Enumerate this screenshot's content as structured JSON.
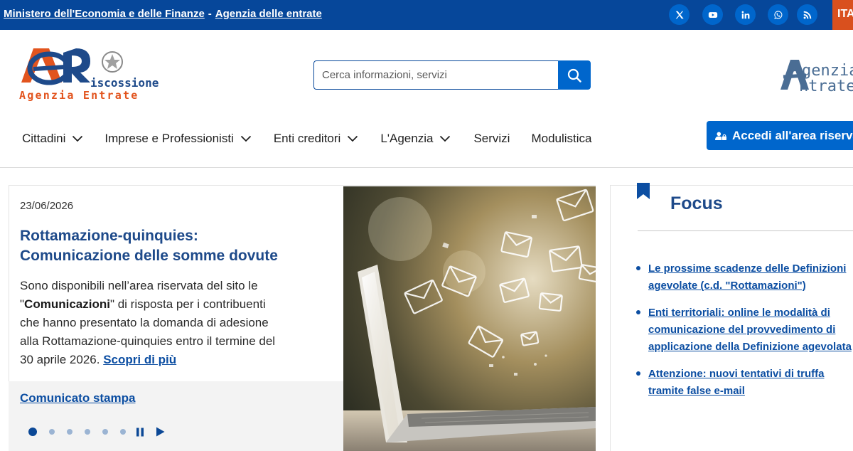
{
  "topbar": {
    "ministry_link": "Ministero dell'Economia e delle Finanze",
    "separator": "-",
    "agency_link": "Agenzia delle entrate",
    "language": "ITA",
    "social": [
      "x-icon",
      "youtube-icon",
      "linkedin-icon",
      "whatsapp-icon",
      "rss-icon"
    ]
  },
  "header": {
    "logo_left_line1": "iscossione",
    "logo_left_line2": "Agenzia Entrate",
    "logo_right_line1": "genzia",
    "logo_right_line2": "ntrate",
    "search": {
      "placeholder": "Cerca informazioni, servizi",
      "value": ""
    }
  },
  "nav": {
    "items": [
      {
        "label": "Cittadini",
        "dropdown": true
      },
      {
        "label": "Imprese e Professionisti",
        "dropdown": true
      },
      {
        "label": "Enti creditori",
        "dropdown": true
      },
      {
        "label": "L'Agenzia",
        "dropdown": true
      },
      {
        "label": "Servizi",
        "dropdown": false
      },
      {
        "label": "Modulistica",
        "dropdown": false
      }
    ],
    "login_label": "Accedi all'area riservata"
  },
  "news": {
    "date": "23/06/2026",
    "title": "Rottamazione-quinquies: Comunicazione delle somme dovute",
    "text_before": "Sono disponibili nell’area riservata del sito le \"",
    "text_bold": "Comunicazioni",
    "text_after": "\" di risposta per i contribuenti che hanno presentato la domanda di adesione alla Rottamazione-quinquies entro il termine del 30 aprile 2026. ",
    "more_link": "Scopri di più",
    "press_link": "Comunicato stampa",
    "carousel": {
      "total_slides": 6,
      "active_slide": 1
    }
  },
  "focus": {
    "title": "Focus",
    "items": [
      "Le prossime scadenze delle Definizioni agevolate (c.d. \"Rottamazioni\")",
      "Enti territoriali: online le modalità di comunicazione del provvedimento di applicazione della Definizione agevolata",
      "Attenzione: nuovi tentativi di truffa tramite false e-mail"
    ]
  },
  "colors": {
    "topbar": "#06479a",
    "primary": "#0066cc",
    "title": "#1e4a8a",
    "lang": "#d9501e"
  }
}
